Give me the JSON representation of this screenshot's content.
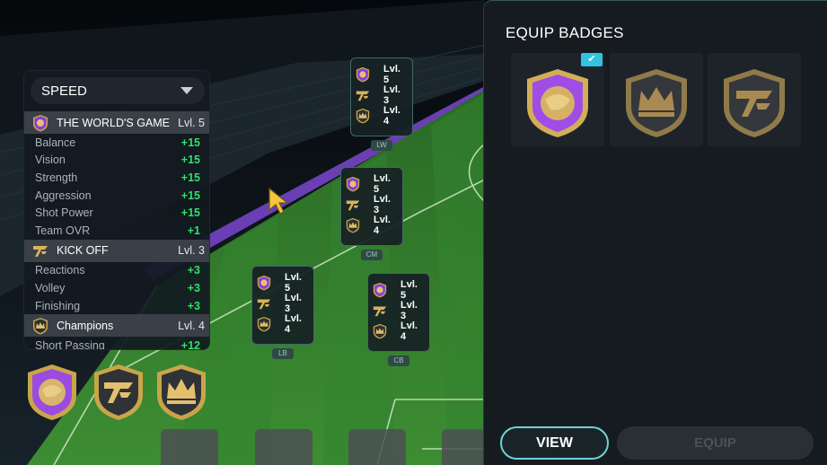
{
  "stats_panel": {
    "dropdown_label": "SPEED",
    "groups": [
      {
        "badge": "world-game-badge",
        "name": "THE WORLD'S GAME",
        "level": "Lvl. 5",
        "stats": [
          {
            "name": "Balance",
            "value": "+15"
          },
          {
            "name": "Vision",
            "value": "+15"
          },
          {
            "name": "Strength",
            "value": "+15"
          },
          {
            "name": "Aggression",
            "value": "+15"
          },
          {
            "name": "Shot Power",
            "value": "+15"
          },
          {
            "name": "Team OVR",
            "value": "+1"
          }
        ]
      },
      {
        "badge": "kick-off-badge",
        "name": "KICK OFF",
        "level": "Lvl. 3",
        "stats": [
          {
            "name": "Reactions",
            "value": "+3"
          },
          {
            "name": "Volley",
            "value": "+3"
          },
          {
            "name": "Finishing",
            "value": "+3"
          }
        ]
      },
      {
        "badge": "champions-badge",
        "name": "Champions",
        "level": "Lvl. 4",
        "stats": [
          {
            "name": "Short Passing",
            "value": "+12"
          }
        ]
      }
    ]
  },
  "formation": [
    {
      "position": "LW",
      "levels": [
        "Lvl. 5",
        "Lvl. 3",
        "Lvl. 4"
      ]
    },
    {
      "position": "CM",
      "levels": [
        "Lvl. 5",
        "Lvl. 3",
        "Lvl. 4"
      ]
    },
    {
      "position": "LB",
      "levels": [
        "Lvl. 5",
        "Lvl. 3",
        "Lvl. 4"
      ]
    },
    {
      "position": "CB",
      "levels": [
        "Lvl. 5",
        "Lvl. 3",
        "Lvl. 4"
      ]
    }
  ],
  "equipped_badges": [
    "world-game-badge",
    "kick-off-badge",
    "champions-badge"
  ],
  "equip_panel": {
    "title": "EQUIP BADGES",
    "badges": [
      "world-game-badge",
      "champions-badge",
      "kick-off-badge"
    ],
    "selected_icon": "checkmark-icon",
    "view_label": "VIEW",
    "equip_label": "EQUIP"
  },
  "colors": {
    "accent_teal": "#6fd3d5",
    "stat_green": "#2fe06a",
    "selected_check": "#33c3e0",
    "pitch_green": "#2d7a2a"
  }
}
